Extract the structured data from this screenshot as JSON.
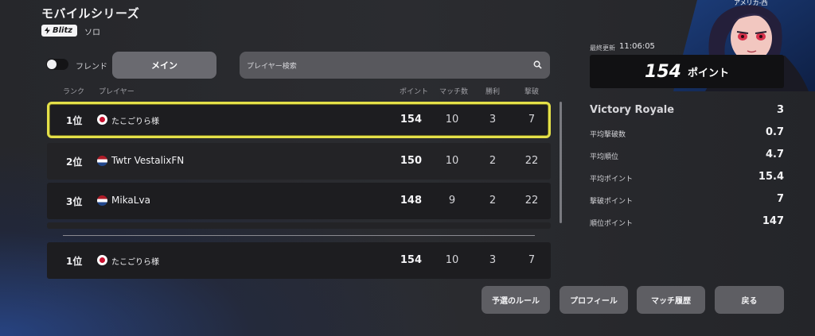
{
  "header": {
    "title": "モバイルシリーズ",
    "badge": "Blitz",
    "mode": "ソロ"
  },
  "controls": {
    "friend_label": "フレンド",
    "main_tab": "メイン",
    "search_placeholder": "プレイヤー検索"
  },
  "columns": {
    "rank": "ランク",
    "player": "プレイヤー",
    "points": "ポイント",
    "matches": "マッチ数",
    "wins": "勝利",
    "kills": "撃破"
  },
  "rows": [
    {
      "rank": "1位",
      "flag": "jp",
      "name": "たこごりら様",
      "points": "154",
      "matches": "10",
      "wins": "3",
      "kills": "7"
    },
    {
      "rank": "2位",
      "flag": "nl",
      "name": "Twtr VestalixFN",
      "points": "150",
      "matches": "10",
      "wins": "2",
      "kills": "22"
    },
    {
      "rank": "3位",
      "flag": "nl",
      "name": "MikaLva",
      "points": "148",
      "matches": "9",
      "wins": "2",
      "kills": "22"
    }
  ],
  "self_row": {
    "rank": "1位",
    "flag": "jp",
    "name": "たこごりら様",
    "points": "154",
    "matches": "10",
    "wins": "3",
    "kills": "7"
  },
  "panel": {
    "region": "アメリカ-西",
    "updated_label": "最終更新",
    "updated_time": "11:06:05",
    "points_value": "154",
    "points_unit": "ポイント",
    "stats": [
      {
        "label": "Victory Royale",
        "value": "3"
      },
      {
        "label": "平均撃破数",
        "value": "0.7"
      },
      {
        "label": "平均順位",
        "value": "4.7"
      },
      {
        "label": "平均ポイント",
        "value": "15.4"
      },
      {
        "label": "撃破ポイント",
        "value": "7"
      },
      {
        "label": "順位ポイント",
        "value": "147"
      }
    ]
  },
  "buttons": {
    "rules": "予選のルール",
    "profile": "プロフィール",
    "history": "マッチ履歴",
    "back": "戻る"
  },
  "colors": {
    "highlight": "#e4e049",
    "button": "#5e5e63",
    "accent_blue": "#2a5ac8"
  },
  "icons": [
    "bolt-icon",
    "search-icon",
    "flag-jp-icon",
    "flag-nl-icon"
  ]
}
